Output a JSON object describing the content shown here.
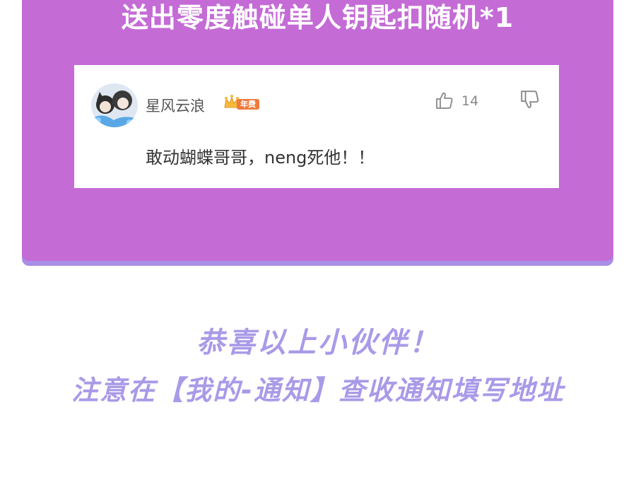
{
  "banner": {
    "title": "送出零度触碰单人钥匙扣随机*1"
  },
  "comment": {
    "username": "星风云浪",
    "badge_label": "年费",
    "like_count": "14",
    "text": "敢动蝴蝶哥哥，neng死他！！",
    "icons": {
      "avatar": "user-avatar",
      "crown": "crown-icon",
      "like": "thumbs-up-icon",
      "dislike": "thumbs-down-icon"
    }
  },
  "message": {
    "congrats": "恭喜以上小伙伴！",
    "notice": "注意在【我的-通知】查收通知填写地址"
  },
  "colors": {
    "panel": "#c46bd6",
    "panel_shadow": "#a88ee6",
    "handwriting": "#a99ae8",
    "badge": "#f07a3c"
  }
}
